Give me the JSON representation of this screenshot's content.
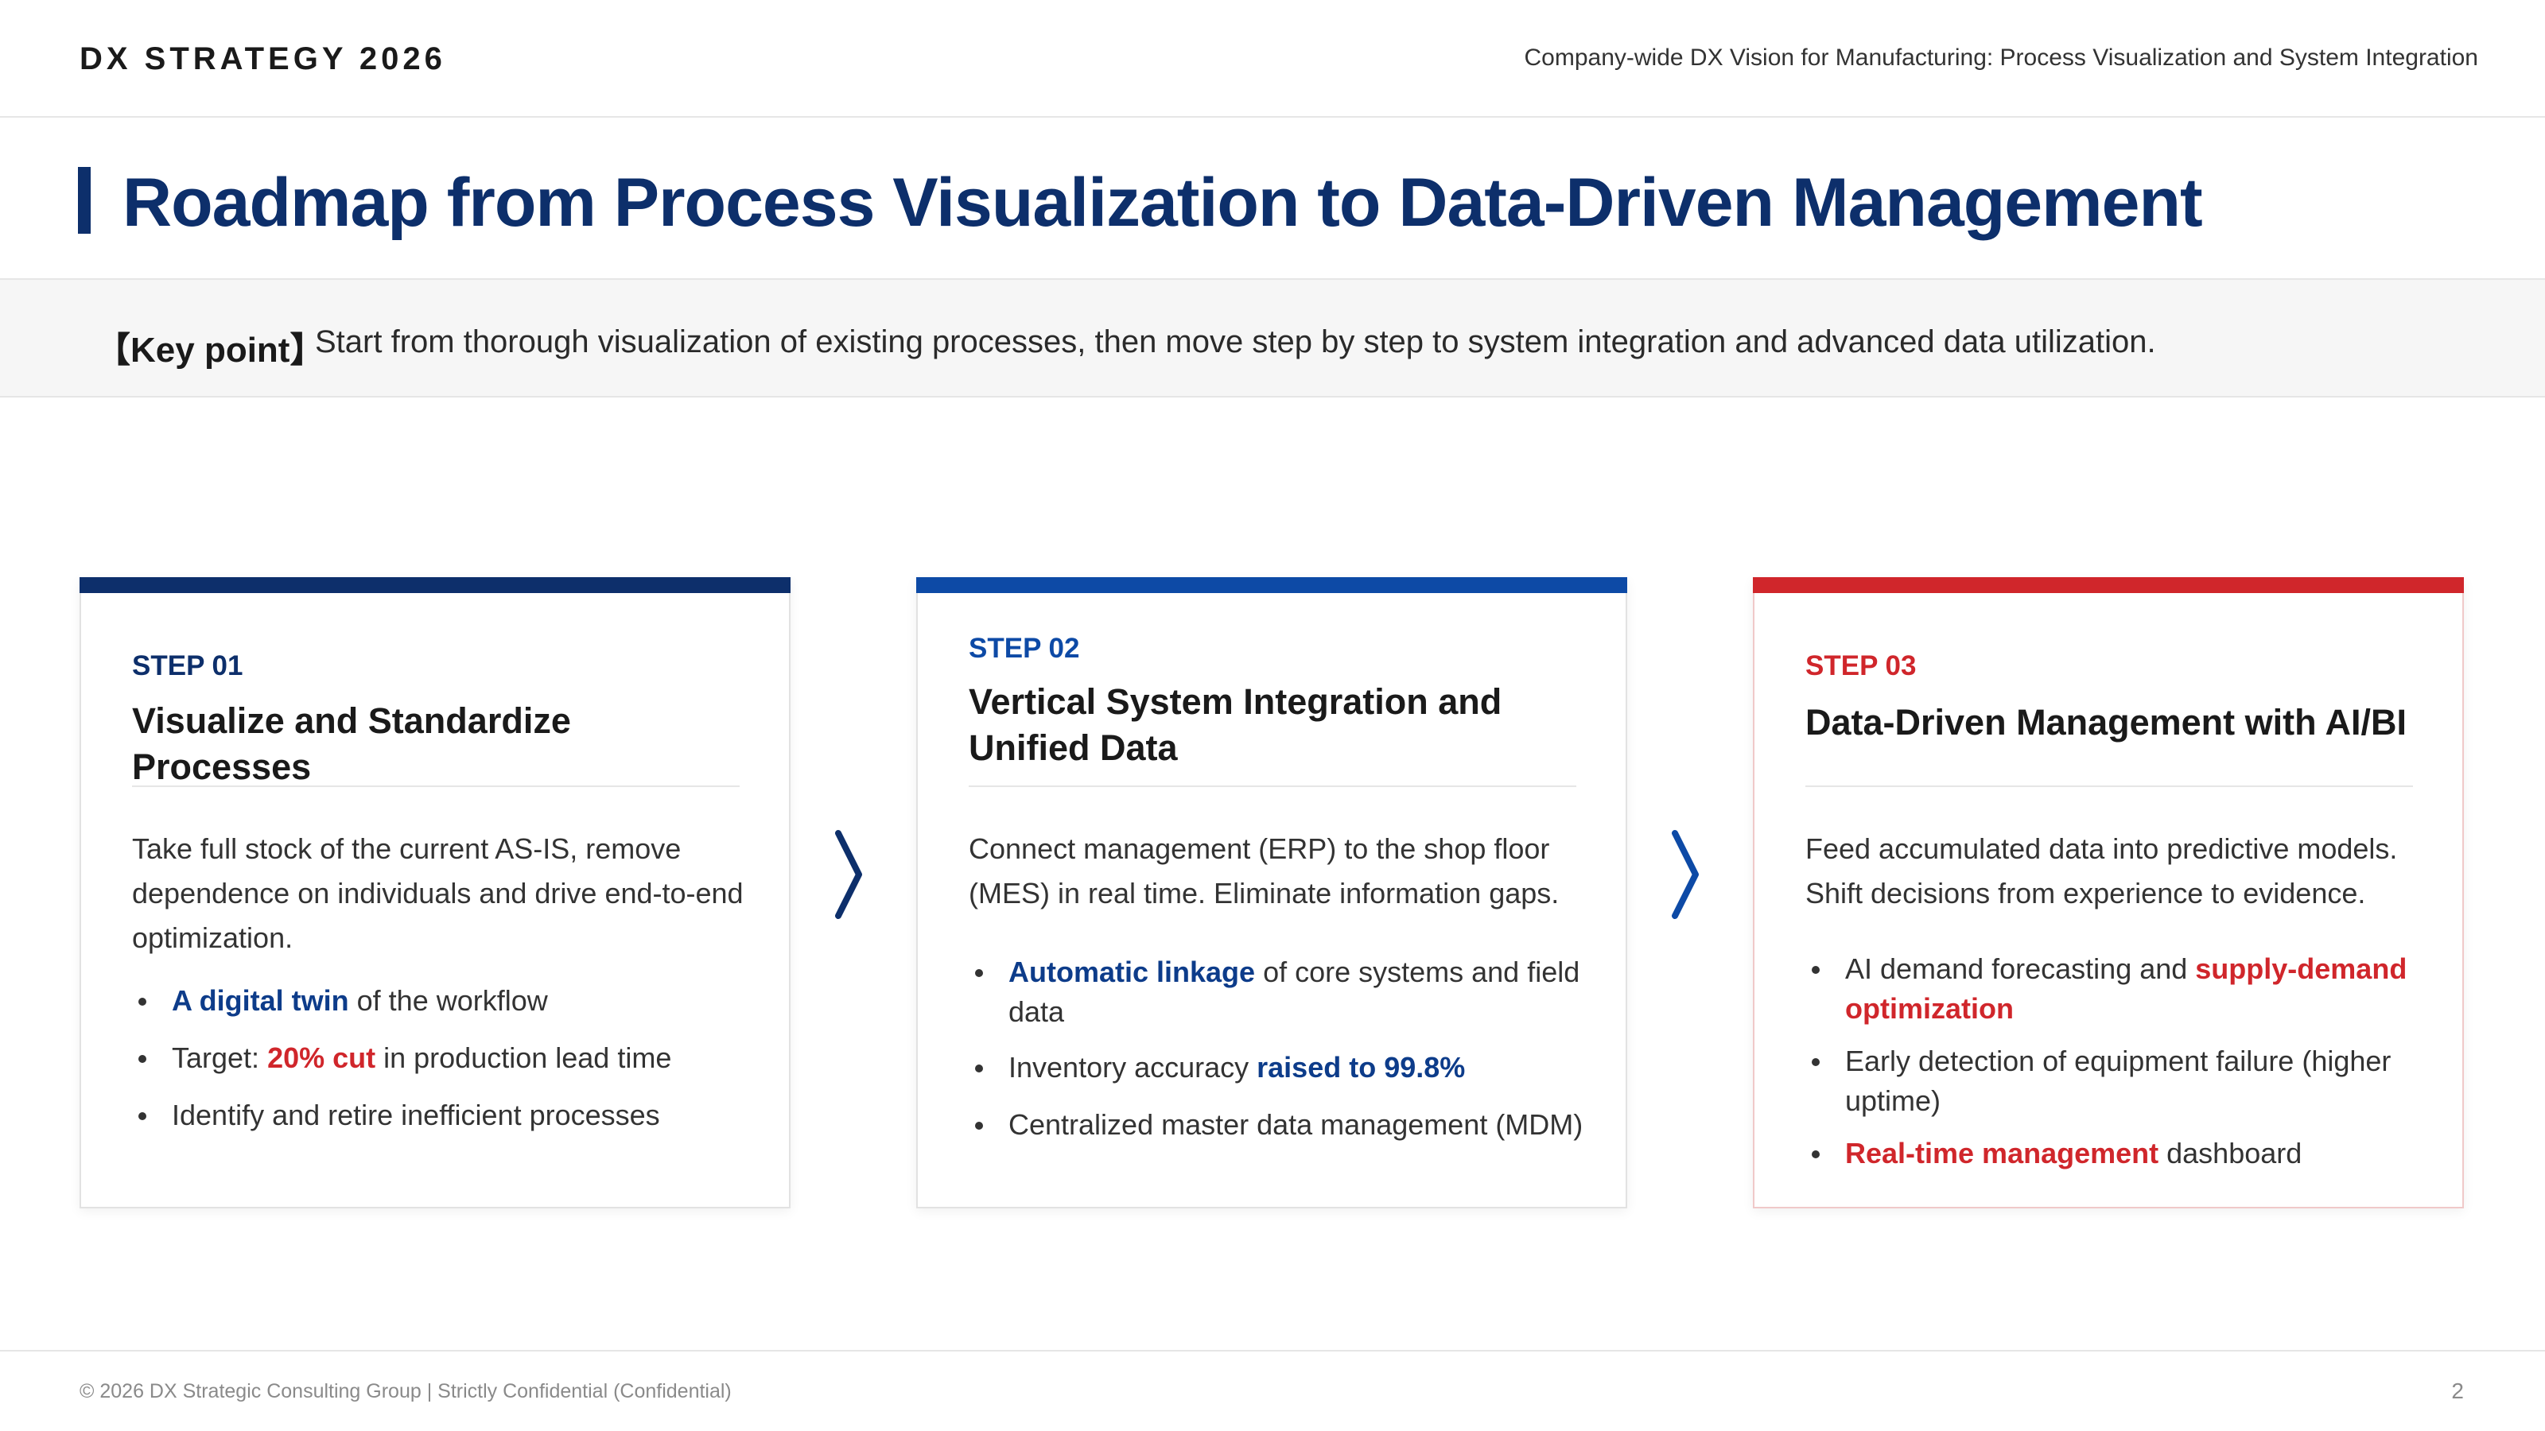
{
  "header": {
    "brand": "DX STRATEGY 2026",
    "subtitle": "Company-wide DX Vision for Manufacturing: Process Visualization and System Integration"
  },
  "title": "Roadmap from Process Visualization to Data-Driven Management",
  "key_point": {
    "label": "【Key point】",
    "text": "Start from thorough visualization of existing processes, then move step by step to system integration and advanced data utilization."
  },
  "colors": {
    "navy": "#0d2f6b",
    "blue": "#0d4aa6",
    "red": "#d0262b",
    "highlight_blue": "#0d3c8a"
  },
  "icons": {
    "step_arrow": "chevron-right-icon"
  },
  "cards": [
    {
      "step": "STEP 01",
      "title": "Visualize and Standardize Processes",
      "description": "Take full stock of the current AS-IS, remove dependence on individuals and drive end-to-end optimization.",
      "bullets": [
        {
          "highlight": "A digital twin",
          "text": " of the workflow"
        },
        {
          "pre": "Target: ",
          "highlight": "20% cut",
          "text": " in production lead time"
        },
        {
          "text": "Identify and retire inefficient processes"
        }
      ]
    },
    {
      "step": "STEP 02",
      "title": "Vertical System Integration and Unified Data",
      "description": "Connect management (ERP) to the shop floor (MES) in real time. Eliminate information gaps.",
      "bullets": [
        {
          "highlight": "Automatic linkage",
          "text": " of core systems and field data"
        },
        {
          "pre": "Inventory accuracy ",
          "highlight": "raised to 99.8%"
        },
        {
          "text": "Centralized master data management (MDM)"
        }
      ]
    },
    {
      "step": "STEP 03",
      "title": "Data-Driven Management with AI/BI",
      "description": "Feed accumulated data into predictive models. Shift decisions from experience to evidence.",
      "bullets": [
        {
          "pre": "AI demand forecasting and ",
          "highlight": "supply-demand optimization"
        },
        {
          "text": "Early detection of equipment failure (higher uptime)"
        },
        {
          "highlight": "Real-time management",
          "text": " dashboard"
        }
      ]
    }
  ],
  "footer": {
    "text": "© 2026 DX Strategic Consulting Group | Strictly Confidential (Confidential)",
    "page": "2"
  }
}
